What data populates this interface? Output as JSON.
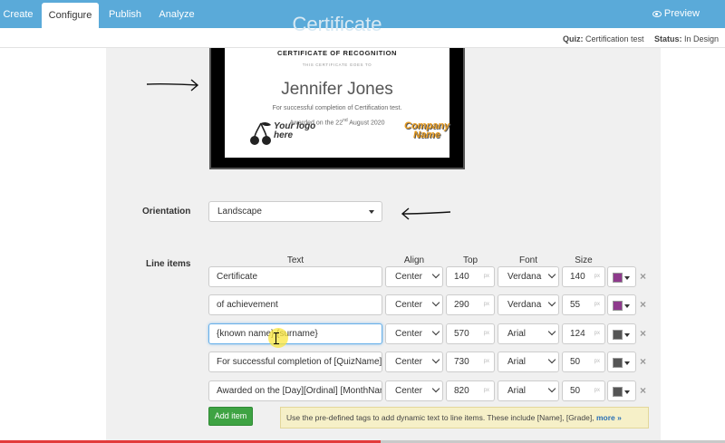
{
  "nav": {
    "tabs": [
      {
        "label": "Create"
      },
      {
        "label": "Configure"
      },
      {
        "label": "Publish"
      },
      {
        "label": "Analyze"
      }
    ],
    "active_tab": "Configure",
    "preview_label": "Preview",
    "preview_icon": "eye-icon"
  },
  "status": {
    "quiz_label": "Quiz:",
    "quiz_value": "Certification test",
    "status_label": "Status:",
    "status_value": "In Design"
  },
  "certificate": {
    "ghost_title": "Certificate",
    "recognition": "CERTIFICATE OF RECOGNITION",
    "goes_to": "THIS CERTIFICATE GOES TO",
    "name": "Jennifer Jones",
    "line1": "For successful completion of Certification test.",
    "line2": "Awarded on the 22nd August 2020",
    "logo_text": "Your logo here",
    "logo_line1": "Your logo",
    "logo_line2": "here",
    "company_text": "Company Name",
    "company_line1": "Company",
    "company_line2": "Name"
  },
  "orientation": {
    "label": "Orientation",
    "value": "Landscape"
  },
  "line_items": {
    "label": "Line items",
    "columns": [
      "Text",
      "Align",
      "Top",
      "Font",
      "Size"
    ],
    "unit": "px",
    "rows": [
      {
        "text": "Certificate",
        "align": "Center",
        "top": "140",
        "font": "Verdana",
        "size": "140",
        "color": "#8e3a8c"
      },
      {
        "text": "of achievement",
        "align": "Center",
        "top": "290",
        "font": "Verdana",
        "size": "55",
        "color": "#8e3a8c"
      },
      {
        "text": "{known name} {surname}",
        "align": "Center",
        "top": "570",
        "font": "Arial",
        "size": "124",
        "color": "#555555"
      },
      {
        "text": "For successful completion of [QuizName]",
        "align": "Center",
        "top": "730",
        "font": "Arial",
        "size": "50",
        "color": "#555555"
      },
      {
        "text": "Awarded on the [Day][Ordinal] [MonthName]",
        "align": "Center",
        "top": "820",
        "font": "Arial",
        "size": "50",
        "color": "#555555"
      }
    ]
  },
  "add_item_label": "Add item",
  "hint": {
    "text": "Use the pre-defined tags to add dynamic text to line items. These include [Name], [Grade],",
    "link": "more »"
  },
  "colors": {
    "nav_bg": "#5aaad9",
    "add_button": "#3ea343",
    "hint_bg": "#f6f0c8"
  }
}
